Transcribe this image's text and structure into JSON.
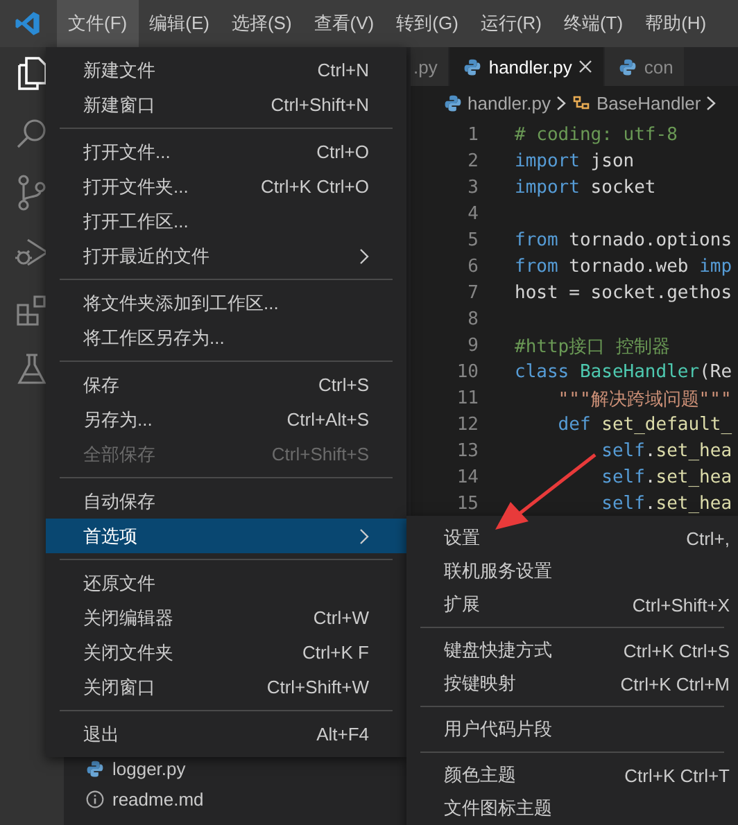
{
  "menubar": [
    {
      "label": "文件(F)",
      "selected": true
    },
    {
      "label": "编辑(E)",
      "selected": false
    },
    {
      "label": "选择(S)",
      "selected": false
    },
    {
      "label": "查看(V)",
      "selected": false
    },
    {
      "label": "转到(G)",
      "selected": false
    },
    {
      "label": "运行(R)",
      "selected": false
    },
    {
      "label": "终端(T)",
      "selected": false
    },
    {
      "label": "帮助(H)",
      "selected": false
    }
  ],
  "explorer": {
    "files": [
      {
        "name": "logger.py",
        "kind": "python"
      },
      {
        "name": "readme.md",
        "kind": "info"
      }
    ]
  },
  "editor": {
    "tabs": [
      {
        "label": ".py",
        "selected": false
      },
      {
        "label": "handler.py",
        "selected": true
      },
      {
        "label": "con",
        "selected": false
      }
    ],
    "breadcrumb": [
      "handler.py",
      "BaseHandler"
    ],
    "lines": [
      {
        "number": "1",
        "tokens": [
          {
            "text": "# coding: utf-8",
            "kind": "comment"
          }
        ]
      },
      {
        "number": "2",
        "tokens": [
          {
            "text": "import",
            "kind": "keyword"
          },
          {
            "text": " json",
            "kind": "plain"
          }
        ]
      },
      {
        "number": "3",
        "tokens": [
          {
            "text": "import",
            "kind": "keyword"
          },
          {
            "text": " socket",
            "kind": "plain"
          }
        ]
      },
      {
        "number": "4"
      },
      {
        "number": "5",
        "tokens": [
          {
            "text": "from",
            "kind": "keyword"
          },
          {
            "text": " tornado.options",
            "kind": "plain"
          }
        ]
      },
      {
        "number": "6",
        "tokens": [
          {
            "text": "from",
            "kind": "keyword"
          },
          {
            "text": " tornado.web ",
            "kind": "plain"
          },
          {
            "text": "imp",
            "kind": "keyword"
          }
        ]
      },
      {
        "number": "7",
        "tokens": [
          {
            "text": "host = socket.gethos",
            "kind": "plain"
          }
        ]
      },
      {
        "number": "8"
      },
      {
        "number": "9",
        "tokens": [
          {
            "text": "#http接口 控制器",
            "kind": "comment"
          }
        ]
      },
      {
        "number": "10",
        "tokens": [
          {
            "text": "class",
            "kind": "keyword"
          },
          {
            "text": " BaseHandler",
            "kind": "class"
          },
          {
            "text": "(Re",
            "kind": "plain"
          }
        ]
      },
      {
        "number": "11",
        "tokens": [
          {
            "text": "    \"\"\"解决跨域问题\"\"\"",
            "kind": "string"
          }
        ]
      },
      {
        "number": "12",
        "tokens": [
          {
            "text": "    def",
            "kind": "keyword"
          },
          {
            "text": " set_default_",
            "kind": "function"
          }
        ]
      },
      {
        "number": "13",
        "tokens": [
          {
            "text": "        self",
            "kind": "keyword"
          },
          {
            "text": ".",
            "kind": "plain"
          },
          {
            "text": "set_hea",
            "kind": "function"
          }
        ]
      },
      {
        "number": "14",
        "tokens": [
          {
            "text": "        self",
            "kind": "keyword"
          },
          {
            "text": ".",
            "kind": "plain"
          },
          {
            "text": "set_hea",
            "kind": "function"
          }
        ]
      },
      {
        "number": "15",
        "tokens": [
          {
            "text": "        self",
            "kind": "keyword"
          },
          {
            "text": ".",
            "kind": "plain"
          },
          {
            "text": "set_hea",
            "kind": "function"
          }
        ]
      }
    ]
  },
  "file_menu": {
    "groups": [
      [
        {
          "label": "新建文件",
          "shortcut": "Ctrl+N",
          "submenu": false,
          "disabled": false,
          "selected": false
        },
        {
          "label": "新建窗口",
          "shortcut": "Ctrl+Shift+N",
          "submenu": false,
          "disabled": false,
          "selected": false
        }
      ],
      [
        {
          "label": "打开文件...",
          "shortcut": "Ctrl+O",
          "submenu": false,
          "disabled": false,
          "selected": false
        },
        {
          "label": "打开文件夹...",
          "shortcut": "Ctrl+K Ctrl+O",
          "submenu": false,
          "disabled": false,
          "selected": false
        },
        {
          "label": "打开工作区...",
          "submenu": false,
          "disabled": false,
          "selected": false
        },
        {
          "label": "打开最近的文件",
          "submenu": true,
          "disabled": false,
          "selected": false
        }
      ],
      [
        {
          "label": "将文件夹添加到工作区...",
          "submenu": false,
          "disabled": false,
          "selected": false
        },
        {
          "label": "将工作区另存为...",
          "submenu": false,
          "disabled": false,
          "selected": false
        }
      ],
      [
        {
          "label": "保存",
          "shortcut": "Ctrl+S",
          "submenu": false,
          "disabled": false,
          "selected": false
        },
        {
          "label": "另存为...",
          "shortcut": "Ctrl+Alt+S",
          "submenu": false,
          "disabled": false,
          "selected": false
        },
        {
          "label": "全部保存",
          "shortcut": "Ctrl+Shift+S",
          "submenu": false,
          "disabled": true,
          "selected": false
        }
      ],
      [
        {
          "label": "自动保存",
          "submenu": false,
          "disabled": false,
          "selected": false
        },
        {
          "label": "首选项",
          "submenu": true,
          "disabled": false,
          "selected": true
        }
      ],
      [
        {
          "label": "还原文件",
          "submenu": false,
          "disabled": false,
          "selected": false
        },
        {
          "label": "关闭编辑器",
          "shortcut": "Ctrl+W",
          "submenu": false,
          "disabled": false,
          "selected": false
        },
        {
          "label": "关闭文件夹",
          "shortcut": "Ctrl+K F",
          "submenu": false,
          "disabled": false,
          "selected": false
        },
        {
          "label": "关闭窗口",
          "shortcut": "Ctrl+Shift+W",
          "submenu": false,
          "disabled": false,
          "selected": false
        }
      ],
      [
        {
          "label": "退出",
          "shortcut": "Alt+F4",
          "submenu": false,
          "disabled": false,
          "selected": false
        }
      ]
    ]
  },
  "preferences_menu": {
    "groups": [
      [
        {
          "label": "设置",
          "shortcut": "Ctrl+,",
          "submenu": false,
          "disabled": false,
          "selected": false
        },
        {
          "label": "联机服务设置",
          "submenu": false,
          "disabled": false,
          "selected": false
        },
        {
          "label": "扩展",
          "shortcut": "Ctrl+Shift+X",
          "submenu": false,
          "disabled": false,
          "selected": false
        }
      ],
      [
        {
          "label": "键盘快捷方式",
          "shortcut": "Ctrl+K Ctrl+S",
          "submenu": false,
          "disabled": false,
          "selected": false
        },
        {
          "label": "按键映射",
          "shortcut": "Ctrl+K Ctrl+M",
          "submenu": false,
          "disabled": false,
          "selected": false
        }
      ],
      [
        {
          "label": "用户代码片段",
          "submenu": false,
          "disabled": false,
          "selected": false
        }
      ],
      [
        {
          "label": "颜色主题",
          "shortcut": "Ctrl+K Ctrl+T",
          "submenu": false,
          "disabled": false,
          "selected": false
        },
        {
          "label": "文件图标主题",
          "submenu": false,
          "disabled": false,
          "selected": false
        }
      ]
    ]
  }
}
